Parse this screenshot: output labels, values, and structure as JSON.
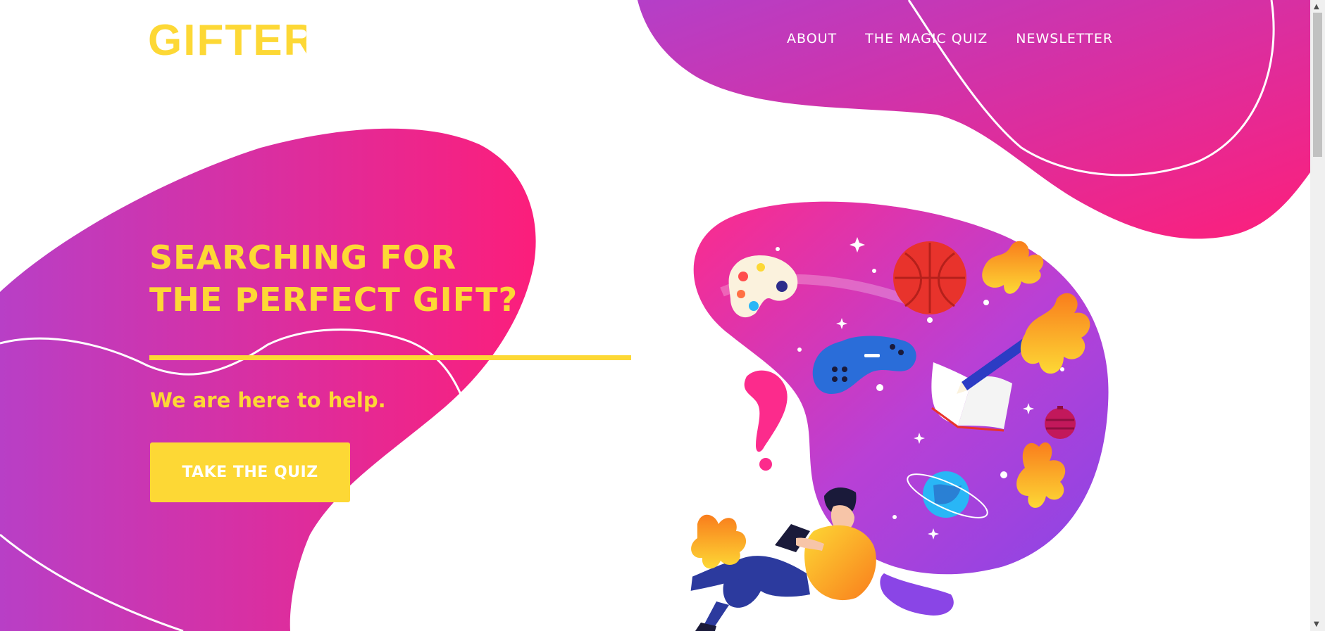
{
  "brand": {
    "logo_text": "GIFTER",
    "color": "#fdd835"
  },
  "nav": {
    "items": [
      {
        "label": "ABOUT"
      },
      {
        "label": "THE MAGIC QUIZ"
      },
      {
        "label": "NEWSLETTER"
      }
    ]
  },
  "hero": {
    "title": "SEARCHING FOR\nTHE PERFECT GIFT?",
    "subtitle": "We are here to help.",
    "cta_label": "TAKE THE QUIZ"
  },
  "colors": {
    "gradient_start": "#b83fc6",
    "gradient_end": "#fc1e7b",
    "accent": "#fdd835",
    "background": "#ffffff"
  },
  "illustration": {
    "icons": [
      "palette-icon",
      "basketball-icon",
      "gamepad-icon",
      "book-icon",
      "pencil-icon",
      "planet-icon",
      "ornament-icon",
      "question-mark-icon"
    ]
  }
}
